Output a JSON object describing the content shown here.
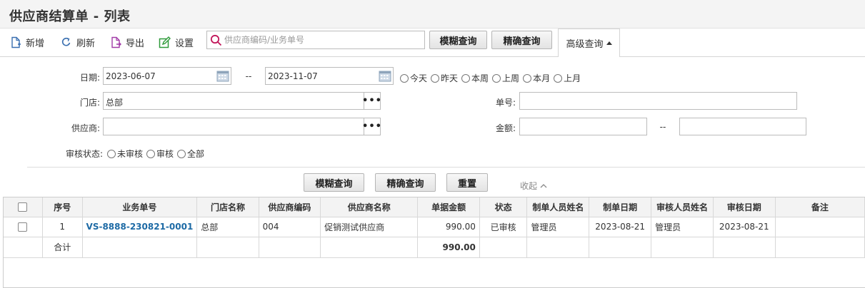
{
  "page": {
    "title": "供应商结算单 - 列表"
  },
  "toolbar": {
    "add_label": "新增",
    "refresh_label": "刷新",
    "export_label": "导出",
    "settings_label": "设置",
    "search_placeholder": "供应商编码/业务单号",
    "fuzzy_label": "模糊查询",
    "exact_label": "精确查询",
    "advanced_label": "高级查询"
  },
  "filters": {
    "date_label": "日期:",
    "date_from": "2023-06-07",
    "date_sep": "--",
    "date_to": "2023-11-07",
    "quick_dates": [
      "今天",
      "昨天",
      "本周",
      "上周",
      "本月",
      "上月"
    ],
    "store_label": "门店:",
    "store_value": "总部",
    "supplier_label": "供应商:",
    "supplier_value": "",
    "order_no_label": "单号:",
    "order_no_value": "",
    "amount_label": "金额:",
    "amount_from": "",
    "amount_sep": "--",
    "amount_to": "",
    "audit_label": "审核状态:",
    "audit_options": [
      "未审核",
      "审核",
      "全部"
    ],
    "fuzzy_label": "模糊查询",
    "exact_label": "精确查询",
    "reset_label": "重置",
    "collapse_label": "收起"
  },
  "table": {
    "headers": [
      "序号",
      "业务单号",
      "门店名称",
      "供应商编码",
      "供应商名称",
      "单据金额",
      "状态",
      "制单人员姓名",
      "制单日期",
      "审核人员姓名",
      "审核日期",
      "备注"
    ],
    "rows": [
      {
        "seq": "1",
        "order_no": "VS-8888-230821-0001",
        "store": "总部",
        "supplier_code": "004",
        "supplier_name": "促销测试供应商",
        "amount": "990.00",
        "status": "已审核",
        "creator": "管理员",
        "create_date": "2023-08-21",
        "auditor": "管理员",
        "audit_date": "2023-08-21",
        "remark": ""
      }
    ],
    "total": {
      "label": "合计",
      "amount": "990.00"
    }
  },
  "colors": {
    "link": "#1d6aa5",
    "header_bg": "#f3f3f3",
    "title_bg": "#f4f4f4"
  }
}
